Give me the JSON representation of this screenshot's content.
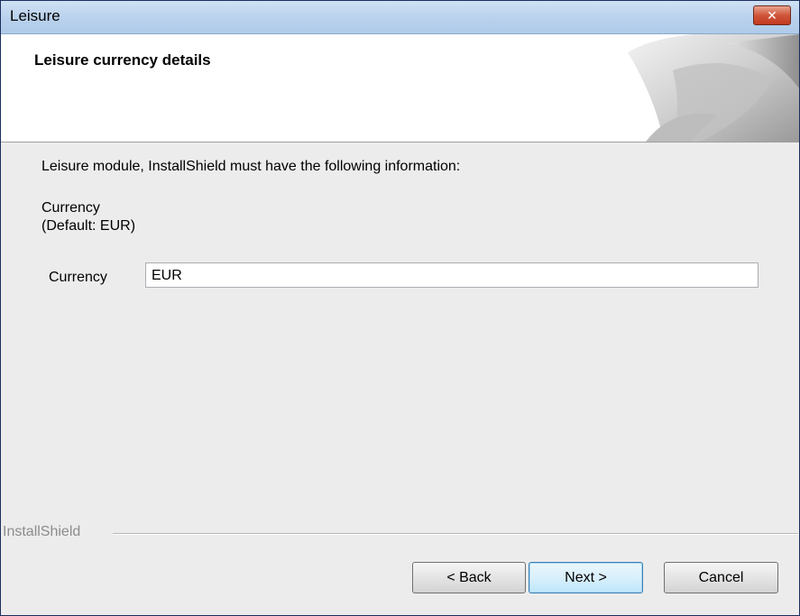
{
  "window": {
    "title": "Leisure",
    "close_label": "✕"
  },
  "header": {
    "title": "Leisure currency details"
  },
  "content": {
    "intro": "Leisure module, InstallShield must have the following information:",
    "field_title": "Currency",
    "field_default": "(Default: EUR)",
    "field_label": "Currency",
    "field_value": "EUR"
  },
  "footer": {
    "brand": "InstallShield",
    "back_label": "< Back",
    "next_label": "Next >",
    "cancel_label": "Cancel"
  }
}
